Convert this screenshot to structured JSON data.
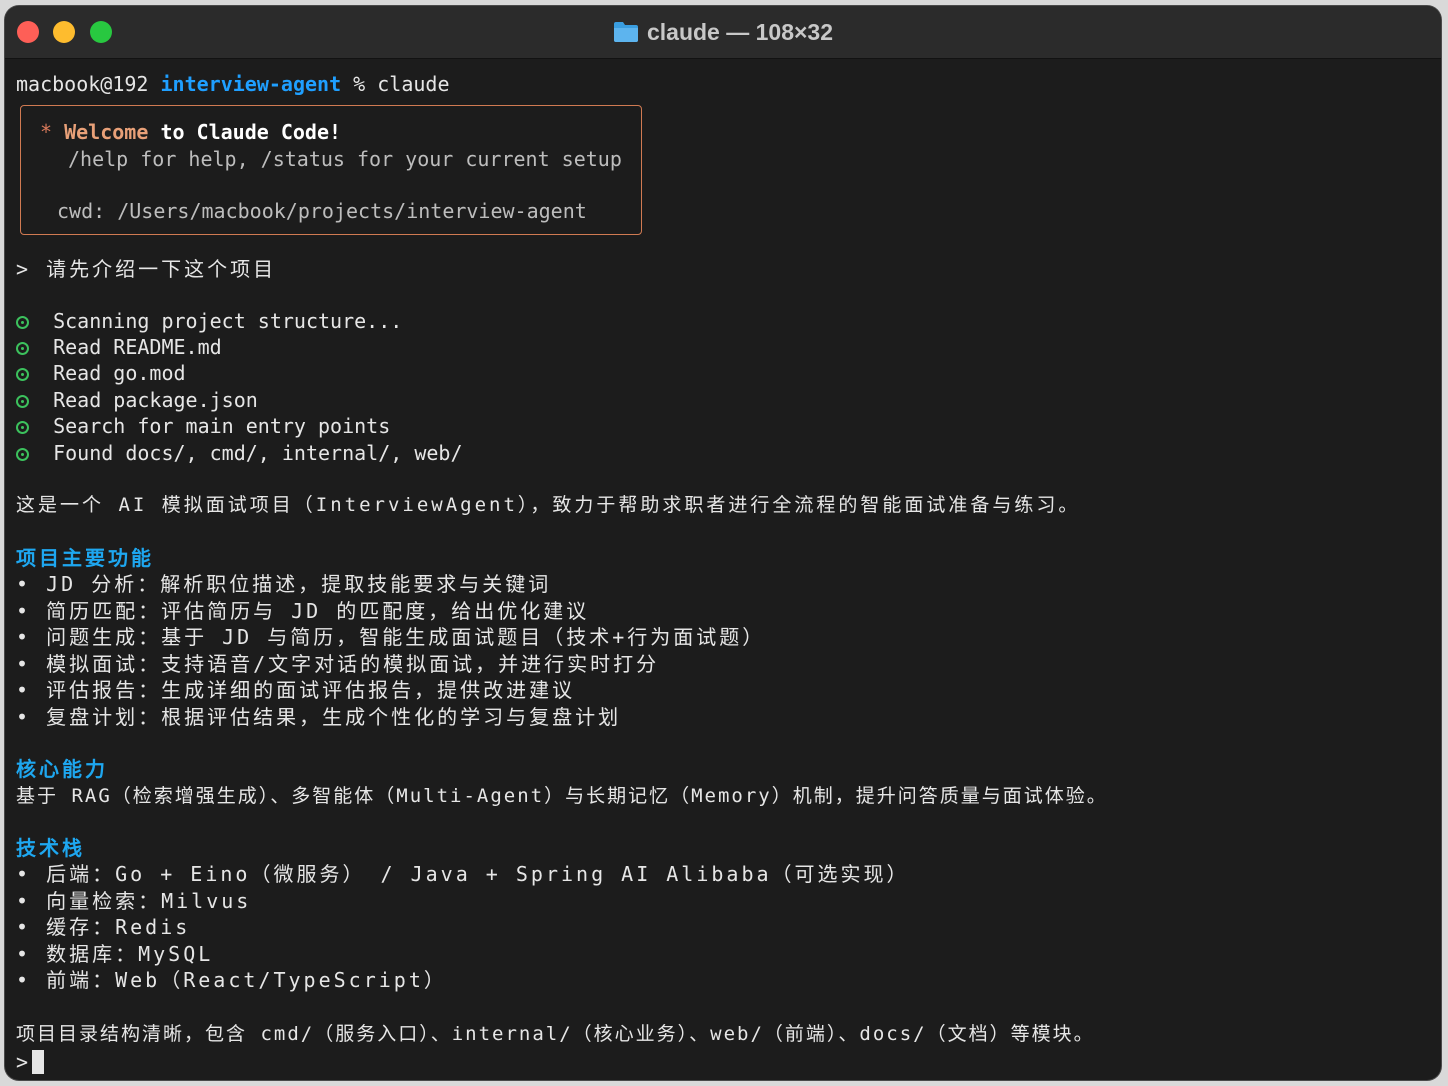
{
  "window": {
    "title": "claude — 108×32",
    "icon": "folder-icon"
  },
  "shell": {
    "host": "macbook@192",
    "dir": "interview-agent",
    "command": "% claude"
  },
  "welcome": {
    "star": "*",
    "welcome_word": "Welcome",
    "welcome_rest": "to Claude Code!",
    "help_line": "/help for help, /status for your current setup",
    "cwd_line": "cwd: /Users/macbook/projects/interview-agent"
  },
  "user_prompt": "> 请先介绍一下这个项目",
  "steps": [
    "Scanning project structure...",
    "Read README.md",
    "Read go.mod",
    "Read package.json",
    "Search for main entry points",
    "Found docs/, cmd/, internal/, web/"
  ],
  "intro": "这是一个 AI 模拟面试项目（InterviewAgent），致力于帮助求职者进行全流程的智能面试准备与练习。",
  "features": {
    "heading": "项目主要功能",
    "items": [
      "• JD 分析：解析职位描述，提取技能要求与关键词",
      "• 简历匹配：评估简历与 JD 的匹配度，给出优化建议",
      "• 问题生成：基于 JD 与简历，智能生成面试题目（技术+行为面试题）",
      "• 模拟面试：支持语音/文字对话的模拟面试，并进行实时打分",
      "• 评估报告：生成详细的面试评估报告，提供改进建议",
      "• 复盘计划：根据评估结果，生成个性化的学习与复盘计划"
    ]
  },
  "core": {
    "heading": "核心能力",
    "text": "基于 RAG（检索增强生成）、多智能体（Multi-Agent）与长期记忆（Memory）机制，提升问答质量与面试体验。"
  },
  "stack": {
    "heading": "技术栈",
    "items": [
      "• 后端：Go + Eino（微服务） / Java + Spring AI Alibaba（可选实现）",
      "• 向量检索：Milvus",
      "• 缓存：Redis",
      "• 数据库：MySQL",
      "• 前端：Web（React/TypeScript）"
    ]
  },
  "summary": "项目目录结构清晰，包含 cmd/（服务入口）、internal/（核心业务）、web/（前端）、docs/（文档）等模块。",
  "input_prompt": ">",
  "colors": {
    "background": "#1c1c1c",
    "directory": "#1f9fff",
    "heading": "#1ea7f0",
    "check": "#3cc15d",
    "welcome_border": "#d07a52"
  }
}
